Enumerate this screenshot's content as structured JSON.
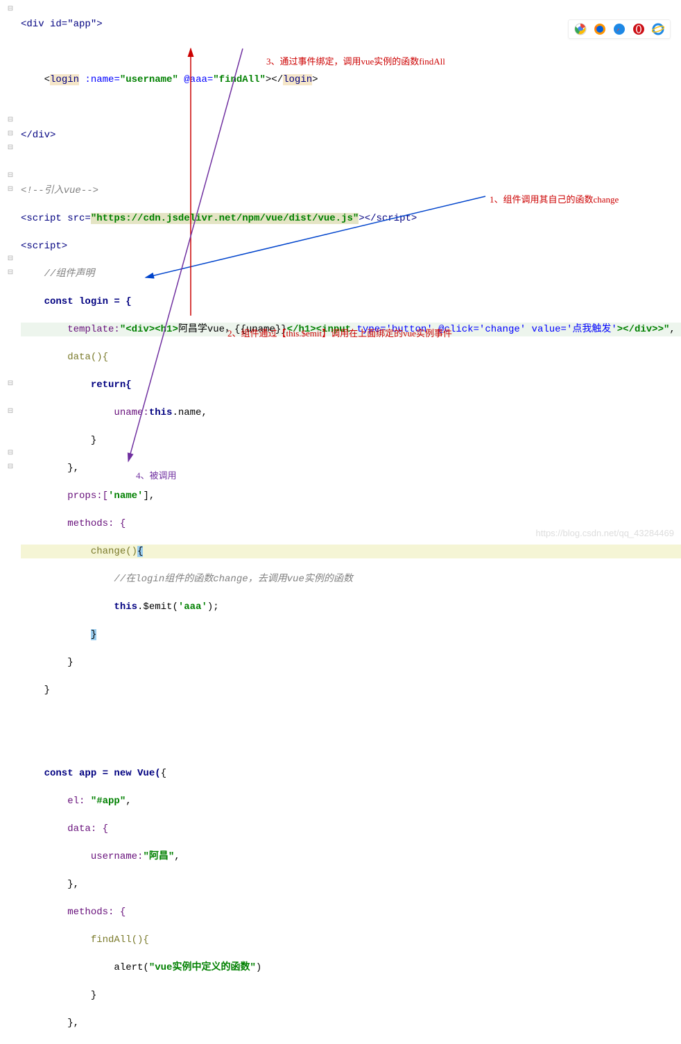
{
  "code": {
    "l1": "<div id=\"app\">",
    "l2": "",
    "l3a": "    <",
    "l3b": "login",
    "l3c": " :name=",
    "l3d": "\"username\"",
    "l3e": " @aaa=",
    "l3f": "\"findAll\"",
    "l3g": "></",
    "l3h": "login",
    "l3i": ">",
    "l4": "",
    "l5": "</div>",
    "l6": "",
    "l7a": "<!--引入vue-->",
    "l8a": "<script src=",
    "l8b": "\"https://cdn.jsdelivr.net/npm/vue/dist/vue.js\"",
    "l8c": "></script>",
    "l9": "<script>",
    "l10": "    //组件声明",
    "l11": "    const login = {",
    "l12a": "        template:",
    "l12b": "\"<div><h1>",
    "l12c": "阿昌学vue，{{uname}}",
    "l12d": "</h1><input ",
    "l12e": "type='button' ",
    "l12f": "@click='change' ",
    "l12g": "value='点我触发'",
    "l12h": "></div>>\"",
    "l12i": ",",
    "l13": "        data(){",
    "l14": "            return{",
    "l15a": "                uname:",
    "l15b": "this",
    "l15c": ".name,",
    "l16": "            }",
    "l17": "        },",
    "l18a": "        props:[",
    "l18b": "'name'",
    "l18c": "],",
    "l19": "        methods: {",
    "l20a": "            change()",
    "l20b": "{",
    "l21": "                //在login组件的函数change，去调用vue实例的函数",
    "l22a": "                ",
    "l22b": "this",
    "l22c": ".$emit(",
    "l22d": "'aaa'",
    "l22e": ");",
    "l23a": "            ",
    "l23b": "}",
    "l24": "        }",
    "l25": "    }",
    "l26": "",
    "l27": "",
    "l28a": "    const app = new Vue(",
    "l28b": "{",
    "l29a": "        el: ",
    "l29b": "\"#app\"",
    "l29c": ",",
    "l30": "        data: {",
    "l31a": "            username:",
    "l31b": "\"阿昌\"",
    "l31c": ",",
    "l32": "        },",
    "l33": "        methods: {",
    "l34": "            findAll(){",
    "l35a": "                alert(",
    "l35b": "\"vue实例中定义的函数\"",
    "l35c": ")",
    "l36": "            }",
    "l37": "        },"
  },
  "annotations": {
    "a1": "1、组件调用其自己的函数change",
    "a2": "2、组件通过【this.$emit】调用在上面绑定的vue实例事件",
    "a3": "3、通过事件绑定，调用vue实例的函数findAll",
    "a4": "4、被调用"
  },
  "icons": {
    "chrome": "chrome-icon",
    "firefox": "firefox-icon",
    "safari": "safari-icon",
    "opera": "opera-icon",
    "ie": "ie-icon"
  },
  "watermark": "https://blog.csdn.net/qq_43284469"
}
